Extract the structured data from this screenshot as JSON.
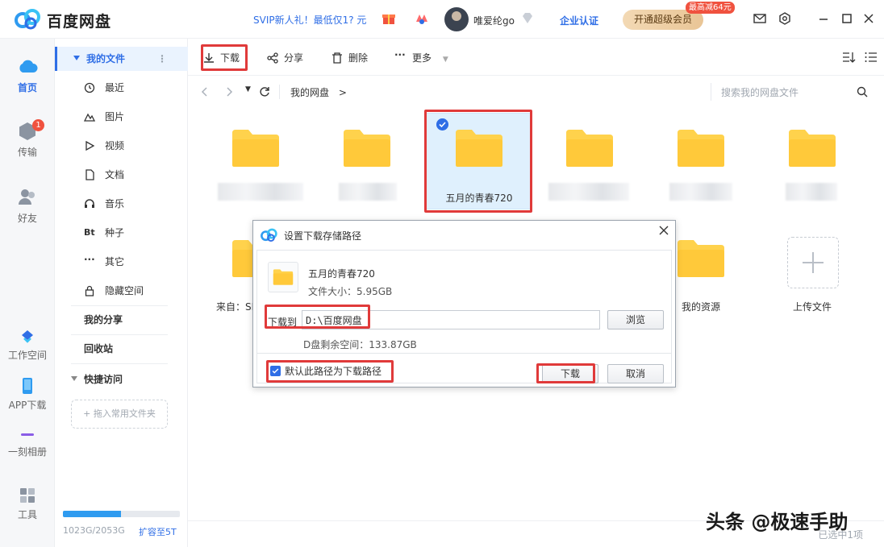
{
  "app": {
    "title": "百度网盘",
    "promo": "SVIP新人礼！最低仅1? 元",
    "username": "唯爱纶go",
    "corp_cert": "企业认证",
    "vip_button": "开通超级会员",
    "vip_tag": "最高减64元"
  },
  "leftnav": [
    {
      "label": "首页",
      "icon": "cloud-icon",
      "active": true
    },
    {
      "label": "传输",
      "icon": "transfer-icon",
      "badge": "1"
    },
    {
      "label": "好友",
      "icon": "friends-icon"
    },
    {
      "label": "工作空间",
      "icon": "workspace-icon"
    },
    {
      "label": "APP下载",
      "icon": "phone-icon"
    },
    {
      "label": "一刻相册",
      "icon": "album-icon"
    },
    {
      "label": "工具",
      "icon": "tools-icon"
    }
  ],
  "sidebar": {
    "my_files": "我的文件",
    "items": [
      {
        "label": "最近",
        "icon": "clock-icon"
      },
      {
        "label": "图片",
        "icon": "image-icon"
      },
      {
        "label": "视频",
        "icon": "play-icon"
      },
      {
        "label": "文档",
        "icon": "document-icon"
      },
      {
        "label": "音乐",
        "icon": "headphones-icon"
      },
      {
        "label": "种子",
        "icon": "bt-icon"
      },
      {
        "label": "其它",
        "icon": "more-icon"
      },
      {
        "label": "隐藏空间",
        "icon": "lock-icon"
      }
    ],
    "my_share": "我的分享",
    "recycle": "回收站",
    "quick_access": "快捷访问",
    "drop_hint": "+ 拖入常用文件夹",
    "quota_text": "1023G/2053G",
    "quota_fraction": 0.498,
    "expand_link": "扩容至5T"
  },
  "toolbar": {
    "download": "下载",
    "share": "分享",
    "delete": "删除",
    "more": "更多"
  },
  "pathbar": {
    "crumb": "我的网盘",
    "sep": ">",
    "search_placeholder": "搜索我的网盘文件"
  },
  "files": {
    "selected_name": "五月的青春720",
    "row2_first_name": "来自：SI",
    "my_resources": "我的资源",
    "upload": "上传文件"
  },
  "dialog": {
    "title": "设置下载存储路径",
    "file_name": "五月的青春720",
    "file_size": "文件大小：5.95GB",
    "download_to": "下载到",
    "path": "D:\\百度网盘",
    "browse": "浏览",
    "free_space": "D盘剩余空间：133.87GB",
    "default_path": "默认此路径为下载路径",
    "download_btn": "下载",
    "cancel_btn": "取消"
  },
  "status": {
    "selected": "已选中1项"
  },
  "watermark": "头条 @极速手助",
  "colors": {
    "accent": "#2f6ee6",
    "folder": "#ffd24c",
    "highlight_box": "#e03a3a"
  }
}
